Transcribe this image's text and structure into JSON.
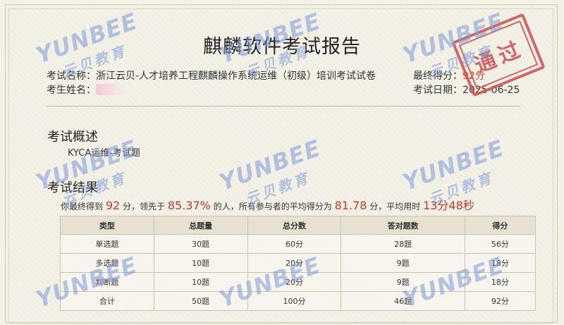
{
  "report": {
    "title": "麒麟软件考试报告",
    "exam_name_label": "考试名称：",
    "exam_name": "浙江云贝-人才培养工程麒麟操作系统运维（初级）培训考试试卷",
    "candidate_label": "考生姓名：",
    "final_score_label": "最终得分：",
    "final_score": "92分",
    "exam_date_label": "考试日期：",
    "exam_date": "2025-06-25",
    "stamp_text": "通过"
  },
  "overview": {
    "heading": "考试概述",
    "subtitle": "KYCA运维-考试题"
  },
  "results": {
    "heading": "考试结果",
    "summary": {
      "t1": "你最终得到",
      "score": "92",
      "t2": "分，领先于",
      "percent": "85.37%",
      "t3": "的人，所有参与者的平均得分为",
      "avg": "81.78",
      "t4": "分，平均用时",
      "time": "13分48秒"
    },
    "table": {
      "headers": [
        "类型",
        "总题量",
        "总分数",
        "答对题数",
        "得分"
      ],
      "rows": [
        [
          "单选题",
          "30题",
          "60分",
          "28题",
          "56分"
        ],
        [
          "多选题",
          "10题",
          "20分",
          "9题",
          "18分"
        ],
        [
          "判断题",
          "10题",
          "20分",
          "9题",
          "18分"
        ],
        [
          "合计",
          "50题",
          "100分",
          "46题",
          "92分"
        ]
      ]
    }
  },
  "watermark": {
    "latin": "YUNBEE",
    "cn": "云贝教育"
  },
  "colors": {
    "accent_red": "#c0392b",
    "stamp_red": "#c94f4f",
    "watermark_blue": "#7d9bd6"
  }
}
